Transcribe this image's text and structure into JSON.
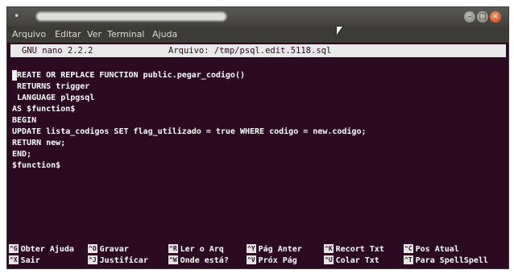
{
  "window": {
    "title": "",
    "buttons": {
      "minimize": "–",
      "maximize": "□",
      "close": "×"
    }
  },
  "menu": [
    "Arquivo",
    "Editar",
    "Ver",
    "Terminal",
    "Ajuda"
  ],
  "nano": {
    "version": "GNU nano 2.2.2",
    "file_label": "Arquivo: /tmp/psql.edit.5118.sql"
  },
  "code": [
    "CREATE OR REPLACE FUNCTION public.pegar_codigo()",
    " RETURNS trigger",
    " LANGUAGE plpgsql",
    "AS $function$",
    "BEGIN",
    "UPDATE lista_codigos SET flag_utilizado = true WHERE codigo = new.codigo;",
    "RETURN new;",
    "END;",
    "$function$"
  ],
  "shortcuts": [
    [
      {
        "key": "^G",
        "label": "Obter Ajuda"
      },
      {
        "key": "^O",
        "label": "Gravar"
      },
      {
        "key": "^R",
        "label": "Ler o Arq"
      },
      {
        "key": "^Y",
        "label": "Pág Anter"
      },
      {
        "key": "^K",
        "label": "Recort Txt"
      },
      {
        "key": "^C",
        "label": "Pos Atual"
      }
    ],
    [
      {
        "key": "^X",
        "label": "Sair"
      },
      {
        "key": "^J",
        "label": "Justificar"
      },
      {
        "key": "^W",
        "label": "Onde está?"
      },
      {
        "key": "^V",
        "label": "Próx Pág"
      },
      {
        "key": "^U",
        "label": "Colar Txt"
      },
      {
        "key": "^T",
        "label": "Para SpellSpell"
      }
    ]
  ],
  "colors": {
    "terminal_bg": "#2c0a22",
    "text": "#ffffff",
    "header_bg": "#e9e9e9",
    "menubar_bg": "#3c3b37",
    "close_button": "#d2481b"
  },
  "icons": {
    "app": "terminal-icon",
    "pointer": "mouse-pointer-icon"
  }
}
